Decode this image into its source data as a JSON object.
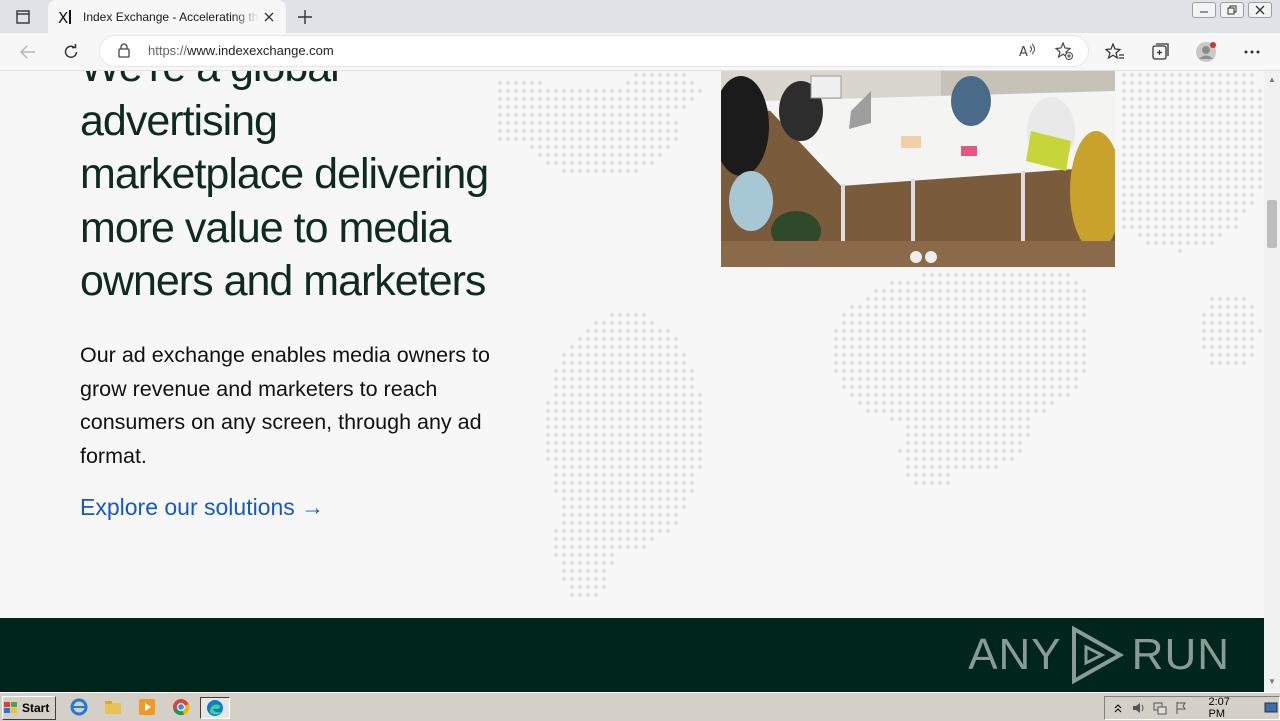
{
  "browser": {
    "tab_title": "Index Exchange - Accelerating th",
    "url_protocol": "https://",
    "url_host": "www.indexexchange.com"
  },
  "page": {
    "headline_lines": [
      "We're a global",
      "advertising",
      "marketplace delivering",
      "more value to media",
      "owners and marketers"
    ],
    "description": "Our ad exchange enables media owners to grow revenue and marketers to reach consumers on any screen, through any ad format.",
    "cta_label": "Explore our solutions →"
  },
  "watermark": {
    "left": "ANY",
    "right": "RUN"
  },
  "taskbar": {
    "start_label": "Start",
    "clock": "2:07 PM"
  },
  "colors": {
    "headline": "#0f2b21",
    "link": "#1559c9",
    "footer": "#00261c"
  }
}
